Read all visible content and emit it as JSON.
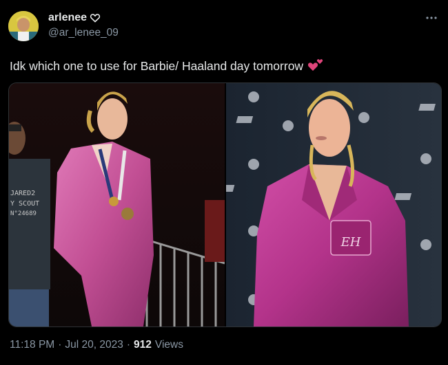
{
  "author": {
    "display_name": "arlenee",
    "handle": "@ar_lenee_09",
    "badge_icon": "heart-outline-icon",
    "avatar_icon": "avatar-photo"
  },
  "tweet": {
    "text": "Idk which one to use for Barbie/ Haaland day tomorrow",
    "emoji_icon": "two-hearts-icon"
  },
  "media": {
    "left_photo_shirt_text": [
      "JARED2",
      "Y SCOUT",
      "N°24689"
    ],
    "right_photo_pocket_monogram": "EH"
  },
  "meta": {
    "time": "11:18 PM",
    "separator1": "·",
    "date": "Jul 20, 2023",
    "separator2": "·",
    "views_count": "912",
    "views_label": "Views"
  },
  "colors": {
    "background": "#000000",
    "text_primary": "#e7e9ea",
    "text_secondary": "#8b98a5",
    "pink_suit": "#c74a96",
    "heart_emoji": "#e0457b"
  },
  "more_icon": "more-horizontal-icon"
}
